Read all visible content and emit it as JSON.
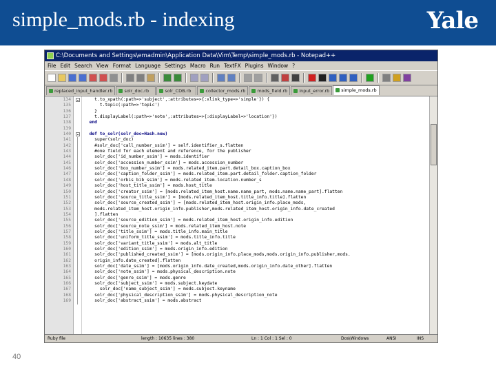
{
  "slide": {
    "title": "simple_mods.rb - indexing",
    "logo": "Yale",
    "page_number": "40"
  },
  "window": {
    "title": "C:\\Documents and Settings\\emadmin\\Application Data\\Vim\\Temp\\simple_mods.rb - Notepad++",
    "menu": [
      "File",
      "Edit",
      "Search",
      "View",
      "Format",
      "Language",
      "Settings",
      "Macro",
      "Run",
      "TextFX",
      "Plugins",
      "Window",
      "?"
    ],
    "tabs": [
      "replaced_input_handler.rb",
      "solr_doc.rb",
      "solr_CDB.rb",
      "collector_mods.rb",
      "mods_field.rb",
      "input_error.rb",
      "simple_mods.rb"
    ],
    "active_tab_index": 6
  },
  "editor": {
    "lines": [
      {
        "n": "134",
        "t": "    t.to_xpath(:path=>'subject',:attributes=>{:xlink_type=>'simple'}) {"
      },
      {
        "n": "135",
        "t": "      t.topic(:path=>'topic')"
      },
      {
        "n": "136",
        "t": "    }"
      },
      {
        "n": "137",
        "t": "    t.displayLabel(:path=>'note',:attributes=>{:displayLabel=>'location'})"
      },
      {
        "n": "138",
        "t": "  end"
      },
      {
        "n": "139",
        "t": ""
      },
      {
        "n": "140",
        "t": "  def to_solr(solr_doc=Hash.new)"
      },
      {
        "n": "141",
        "t": "    super(solr_doc)"
      },
      {
        "n": "142",
        "t": "    #solr_doc['call_number_ssim'] = self.identifier_s.flatten"
      },
      {
        "n": "143",
        "t": "    #one field for each element and reference, for the publisher"
      },
      {
        "n": "144",
        "t": "    solr_doc['id_number_ssim'] = mods.identifier"
      },
      {
        "n": "145",
        "t": "    solr_doc['accession_number_ssim'] = mods.accession_number"
      },
      {
        "n": "146",
        "t": "    solr_doc['box_number_ssim'] = mods.related_item.part.detail_box.caption_box"
      },
      {
        "n": "147",
        "t": "    solr_doc['caption_folder_ssim'] = mods.related_item.part.detail_folder.caption_folder"
      },
      {
        "n": "148",
        "t": "    solr_doc['orbis_bib_ssim'] = mods.related_item.location.number_s"
      },
      {
        "n": "149",
        "t": "    solr_doc['host_title_ssim'] = mods.host_title"
      },
      {
        "n": "150",
        "t": "    solr_doc['creator_ssim'] = [mods.related_item_host.name.name_part, mods.name.name_part].flatten"
      },
      {
        "n": "151",
        "t": "    solr_doc['source_title_ssim'] = [mods.related_item_host.title_info.title].flatten"
      },
      {
        "n": "152",
        "t": "    solr_doc['source_created_ssim'] = [mods.related_item_host.origin_info.place_mods,"
      },
      {
        "n": "153",
        "t": "    mods.related_item_host.origin_info.publisher,mods.related_item_host.origin_info.date_created"
      },
      {
        "n": "154",
        "t": "    ].flatten"
      },
      {
        "n": "155",
        "t": "    solr_doc['source_edition_ssim'] = mods.related_item_host.origin_info.edition"
      },
      {
        "n": "156",
        "t": "    solr_doc['source_note_ssim'] = mods.related_item_host.note"
      },
      {
        "n": "157",
        "t": "    solr_doc['title_ssim'] = mods.title_info.main_title"
      },
      {
        "n": "158",
        "t": "    solr_doc['uniform_title_ssim'] = mods.title_info.title"
      },
      {
        "n": "159",
        "t": "    solr_doc['variant_title_ssim'] = mods.alt_title"
      },
      {
        "n": "160",
        "t": "    solr_doc['edition_ssim'] = mods.origin_info.edition"
      },
      {
        "n": "161",
        "t": "    solr_doc['published_created_ssim'] = [mods.origin_info.place_mods,mods.origin_info.publisher,mods."
      },
      {
        "n": "162",
        "t": "    origin_info.date_created].flatten"
      },
      {
        "n": "163",
        "t": "    solr_doc['date_ssim'] = [mods.origin_info.date_created,mods.origin_info.date_other].flatten"
      },
      {
        "n": "164",
        "t": "    solr_doc['note_ssim'] = mods.physical_description.note"
      },
      {
        "n": "165",
        "t": "    solr_doc['genre_ssim'] = mods.genre"
      },
      {
        "n": "166",
        "t": "    solr_doc['subject_ssim'] = mods.subject.keydate"
      },
      {
        "n": "167",
        "t": "      solr_doc['name_subject_ssim'] = mods.subject.keyname"
      },
      {
        "n": "168",
        "t": "    solr_doc['physical_description_ssim'] = mods.physical_description_note"
      },
      {
        "n": "169",
        "t": "    solr_doc['abstract_ssim'] = mods.abstract"
      }
    ]
  },
  "status": {
    "file_type": "Ruby file",
    "length": "length : 10635    lines : 380",
    "position": "Ln : 1    Col : 1    Sel : 0",
    "eol": "Dos\\Windows",
    "encoding": "ANSI",
    "mode": "INS"
  }
}
